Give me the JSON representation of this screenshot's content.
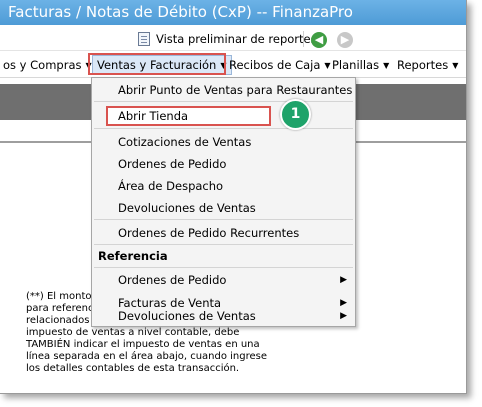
{
  "window": {
    "title": "Facturas / Notas de Débito (CxP) -- FinanzaPro"
  },
  "toolbar": {
    "preview_label": "Vista preliminar de reportes",
    "back_glyph": "◀",
    "forward_glyph": "▶"
  },
  "menubar": {
    "items": [
      {
        "label": "os y Compras"
      },
      {
        "label": "Ventas y Facturación"
      },
      {
        "label": "Recibos de Caja"
      },
      {
        "label": "Planillas"
      },
      {
        "label": "Reportes"
      }
    ],
    "arrow_glyph": "▼"
  },
  "dropdown": {
    "items": [
      {
        "label": "Abrir Punto de Ventas para Restaurantes"
      },
      {
        "label": "Abrir Tienda"
      },
      {
        "label": "Cotizaciones de Ventas"
      },
      {
        "label": "Ordenes de Pedido"
      },
      {
        "label": "Área de Despacho"
      },
      {
        "label": "Devoluciones de Ventas"
      },
      {
        "label": "Ordenes de Pedido Recurrentes"
      }
    ],
    "section_header": "Referencia",
    "submenu_items": [
      {
        "label": "Ordenes de Pedido"
      },
      {
        "label": "Facturas de Venta"
      },
      {
        "label": "Devoluciones de Ventas"
      }
    ],
    "submenu_arrow": "▶"
  },
  "callout": {
    "number": "1",
    "color": "#1fa36a"
  },
  "note": {
    "lines": [
      "(**) El monto c",
      "para referenci",
      "relacionados a",
      "impuesto de ventas a nivel contable, debe",
      "TAMBIÉN indicar el impuesto de ventas en una",
      "línea separada en el área abajo, cuando ingrese",
      "los detalles contables de esta transacción."
    ]
  },
  "colors": {
    "title_bar": "#56a3dc",
    "highlight_border": "#d9534f",
    "band": "#6f6f6f"
  }
}
